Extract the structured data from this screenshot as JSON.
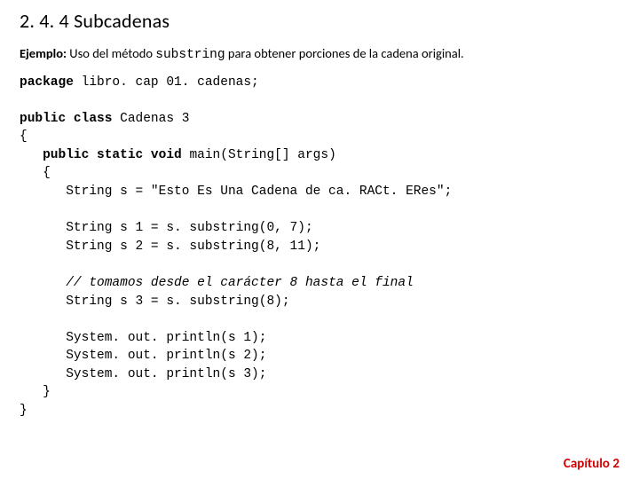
{
  "heading": "2. 4. 4 Subcadenas",
  "intro": {
    "prefix": "Ejemplo:",
    "before": " Uso del método ",
    "code": "substring",
    "after": " para obtener porciones de la cadena original."
  },
  "code": {
    "l1_kw": "package",
    "l1_rest": " libro. cap 01. cadenas;",
    "l2_kw": "public class",
    "l2_rest": " Cadenas 3",
    "l3": "{",
    "l4_pad": "   ",
    "l4_kw": "public static void",
    "l4_rest": " main(String[] args)",
    "l5": "   {",
    "l6": "      String s = \"Esto Es Una Cadena de ca. RACt. ERes\";",
    "l7": "      String s 1 = s. substring(0, 7);",
    "l8": "      String s 2 = s. substring(8, 11);",
    "l9_pad": "      ",
    "l9_comment": "// tomamos desde el carácter 8 hasta el final",
    "l10": "      String s 3 = s. substring(8);",
    "l11": "      System. out. println(s 1);",
    "l12": "      System. out. println(s 2);",
    "l13": "      System. out. println(s 3);",
    "l14": "   }",
    "l15": "}"
  },
  "footer": "Capítulo 2"
}
